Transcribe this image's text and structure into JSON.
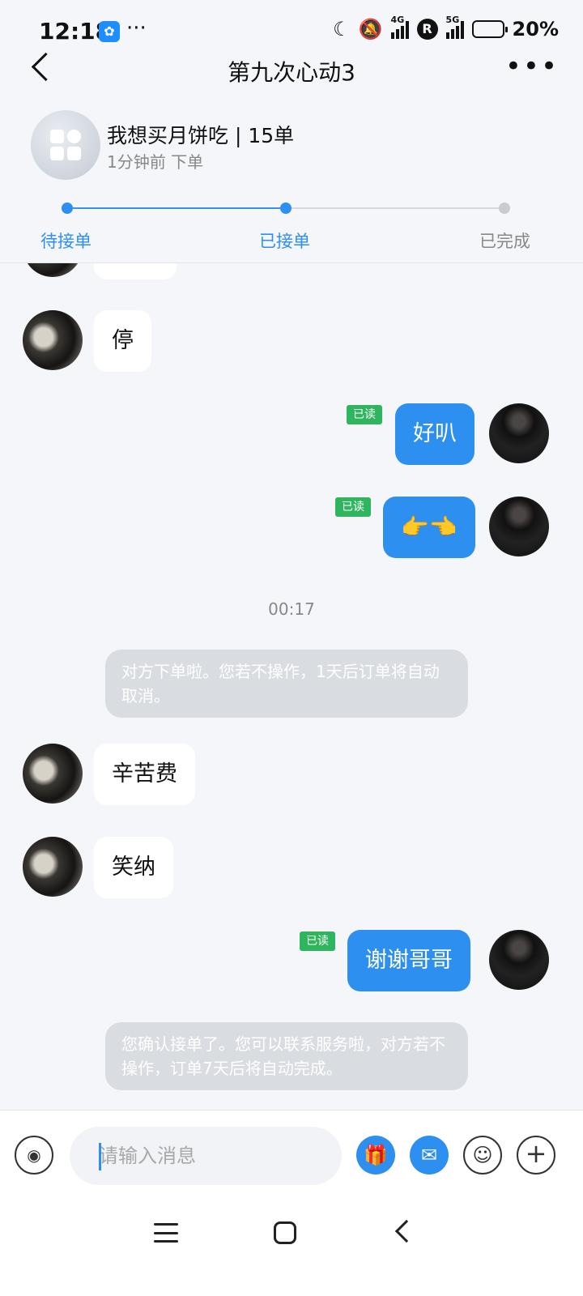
{
  "status_bar": {
    "time": "12:18",
    "app_icon": "baidu-paw-icon",
    "more": "···",
    "network_4g": "4G",
    "network_5g": "5G",
    "r_badge": "R",
    "battery": "20%",
    "battery_level": 0.2
  },
  "header": {
    "title": "第九次心动3"
  },
  "order": {
    "title": "我想买月饼吃 | 15单",
    "subtitle": "1分钟前 下单"
  },
  "progress": {
    "steps": [
      "待接单",
      "已接单",
      "已完成"
    ],
    "active_color": "#3a92f0",
    "inactive_color": "#c8cbd1"
  },
  "chat": {
    "read_label": "已读",
    "messages": [
      {
        "side": "left",
        "text": "停"
      },
      {
        "side": "right",
        "text": "好叭"
      },
      {
        "side": "right",
        "text": "👉👈"
      },
      {
        "side": "left",
        "text": "辛苦费"
      },
      {
        "side": "left",
        "text": "笑纳"
      },
      {
        "side": "right",
        "text": "谢谢哥哥"
      }
    ],
    "timestamp": "00:17",
    "system_messages": [
      "对方下单啦。您若不操作，1天后订单将自动取消。",
      "您确认接单了。您可以联系服务啦，对方若不操作，订单7天后将自动完成。"
    ]
  },
  "input_bar": {
    "placeholder": "请输入消息",
    "icons": [
      "voice-icon",
      "gift-icon",
      "red-packet-icon",
      "smile-icon",
      "plus-icon"
    ]
  },
  "colors": {
    "accent": "#2d8ff0",
    "read_tag": "#2fb55e",
    "background": "#f4f6f9"
  }
}
